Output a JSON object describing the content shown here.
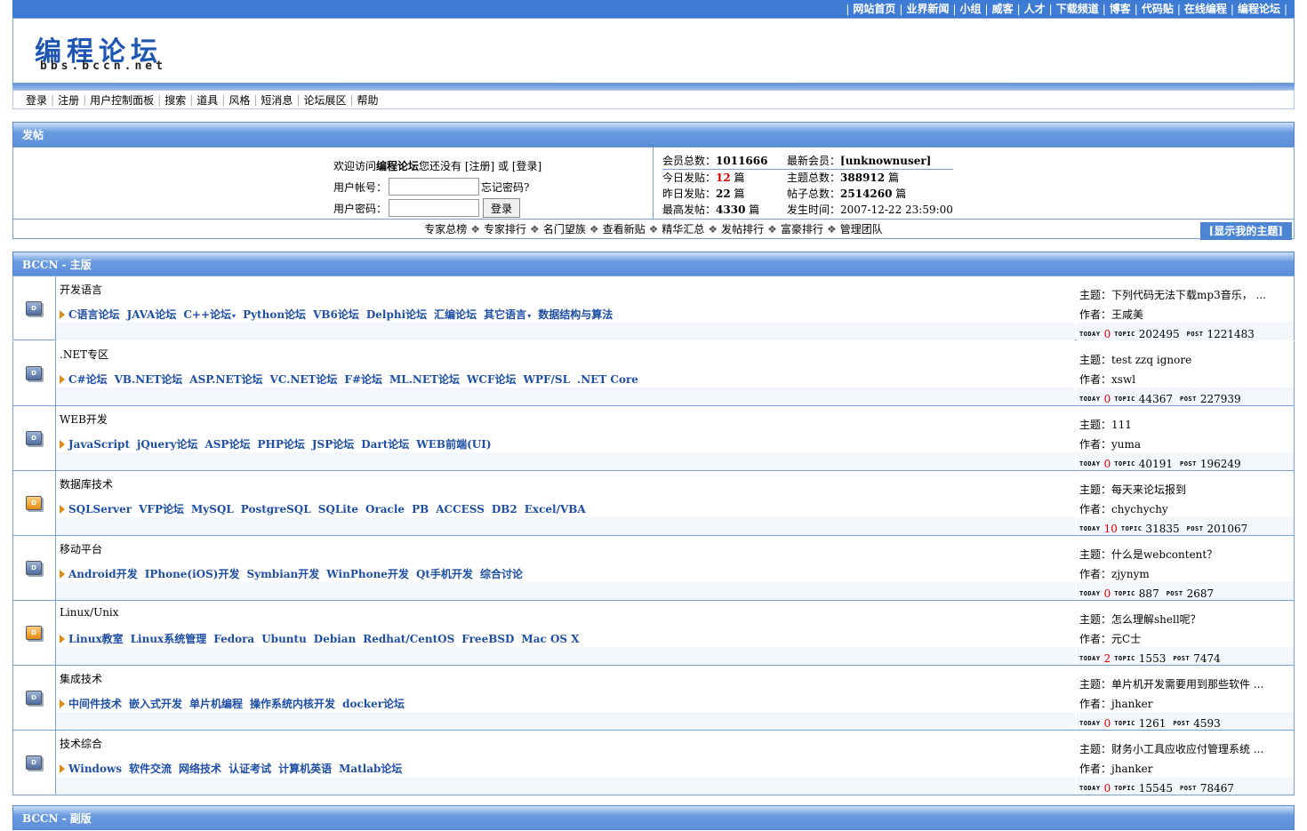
{
  "top_links": [
    "网站首页",
    "业界新闻",
    "小组",
    "威客",
    "人才",
    "下载频道",
    "博客",
    "代码贴",
    "在线编程",
    "编程论坛"
  ],
  "logo": {
    "main": "编程论坛",
    "sub": "bbs.bccn.net"
  },
  "menu": [
    "登录",
    "注册",
    "用户控制面板",
    "搜索",
    "道具",
    "风格",
    "短消息",
    "论坛展区",
    "帮助"
  ],
  "post_section": {
    "title": "发帖"
  },
  "login": {
    "welcome_prefix": "欢迎访问 ",
    "site": "编程论坛",
    "welcome_suffix": " 您还没有 [注册] 或 [登录]",
    "account_label": "用户帐号：",
    "forgot": "忘记密码?",
    "password_label": "用户密码：",
    "button": "登录"
  },
  "stats": {
    "members_label": "会员总数：",
    "members": "1011666",
    "newest_label": "最新会员：",
    "newest": "[unknownuser]",
    "today_label": "今日发贴：",
    "today": "12",
    "unit": " 篇",
    "topics_label": "主题总数：",
    "topics": "388912",
    "yesterday_label": "昨日发贴：",
    "yesterday": "22",
    "posts_label": "帖子总数：",
    "posts": "2514260",
    "max_label": "最高发帖：",
    "max": "4330",
    "time_label": "发生时间：",
    "time": "2007-12-22 23:59:00"
  },
  "tools": [
    "专家总榜",
    "专家排行",
    "名门望族",
    "查看新贴",
    "精华汇总",
    "发帖排行",
    "富豪排行",
    "管理团队"
  ],
  "my_topics": "[显示我的主题]",
  "main_section": {
    "title": "BCCN - 主版"
  },
  "sub_section": {
    "title": "BCCN - 副版"
  },
  "labels": {
    "topic": "主题：",
    "author": "作者：",
    "today_tag": "TODAY",
    "topic_tag": "TOPIC",
    "post_tag": "POST",
    "dropdown": "▾"
  },
  "forums": [
    {
      "name": "开发语言",
      "icon": "blue",
      "subs": [
        {
          "t": "C语言论坛"
        },
        {
          "t": "JAVA论坛"
        },
        {
          "t": "C++论坛",
          "dd": true
        },
        {
          "t": "Python论坛"
        },
        {
          "t": "VB6论坛"
        },
        {
          "t": "Delphi论坛"
        },
        {
          "t": "汇编论坛"
        },
        {
          "t": "其它语言",
          "dd": true
        },
        {
          "t": "数据结构与算法"
        }
      ],
      "last_topic": "下列代码无法下载mp3音乐， ...",
      "author": "王咸美",
      "today": "0",
      "topics": "202495",
      "posts": "1221483"
    },
    {
      "name": ".NET专区",
      "icon": "blue",
      "subs": [
        {
          "t": "C#论坛"
        },
        {
          "t": "VB.NET论坛"
        },
        {
          "t": "ASP.NET论坛"
        },
        {
          "t": "VC.NET论坛"
        },
        {
          "t": "F#论坛"
        },
        {
          "t": "ML.NET论坛"
        },
        {
          "t": "WCF论坛"
        },
        {
          "t": "WPF/SL"
        },
        {
          "t": ".NET Core"
        }
      ],
      "last_topic": "test zzq ignore",
      "author": "xswl",
      "today": "0",
      "topics": "44367",
      "posts": "227939"
    },
    {
      "name": "WEB开发",
      "icon": "blue",
      "subs": [
        {
          "t": "JavaScript"
        },
        {
          "t": "jQuery论坛"
        },
        {
          "t": "ASP论坛"
        },
        {
          "t": "PHP论坛"
        },
        {
          "t": "JSP论坛"
        },
        {
          "t": "Dart论坛"
        },
        {
          "t": "WEB前端(UI)"
        }
      ],
      "last_topic": "111",
      "author": "yuma",
      "today": "0",
      "topics": "40191",
      "posts": "196249"
    },
    {
      "name": "数据库技术",
      "icon": "orange",
      "subs": [
        {
          "t": "SQLServer"
        },
        {
          "t": "VFP论坛"
        },
        {
          "t": "MySQL"
        },
        {
          "t": "PostgreSQL"
        },
        {
          "t": "SQLite"
        },
        {
          "t": "Oracle"
        },
        {
          "t": "PB"
        },
        {
          "t": "ACCESS"
        },
        {
          "t": "DB2"
        },
        {
          "t": "Excel/VBA"
        }
      ],
      "last_topic": "每天来论坛报到",
      "author": "chychychy",
      "today": "10",
      "topics": "31835",
      "posts": "201067"
    },
    {
      "name": "移动平台",
      "icon": "blue",
      "subs": [
        {
          "t": "Android开发"
        },
        {
          "t": "IPhone(iOS)开发"
        },
        {
          "t": "Symbian开发"
        },
        {
          "t": "WinPhone开发"
        },
        {
          "t": "Qt手机开发"
        },
        {
          "t": "综合讨论"
        }
      ],
      "last_topic": "什么是webcontent？",
      "author": "zjynym",
      "today": "0",
      "topics": "887",
      "posts": "2687"
    },
    {
      "name": "Linux/Unix",
      "icon": "orange",
      "subs": [
        {
          "t": "Linux教室"
        },
        {
          "t": "Linux系统管理"
        },
        {
          "t": "Fedora"
        },
        {
          "t": "Ubuntu"
        },
        {
          "t": "Debian"
        },
        {
          "t": "Redhat/CentOS"
        },
        {
          "t": "FreeBSD"
        },
        {
          "t": "Mac OS X"
        }
      ],
      "last_topic": "怎么理解shell呢？",
      "author": "元C士",
      "today": "2",
      "topics": "1553",
      "posts": "7474"
    },
    {
      "name": "集成技术",
      "icon": "blue",
      "subs": [
        {
          "t": "中间件技术"
        },
        {
          "t": "嵌入式开发"
        },
        {
          "t": "单片机编程"
        },
        {
          "t": "操作系统内核开发"
        },
        {
          "t": "docker论坛"
        }
      ],
      "last_topic": "单片机开发需要用到那些软件 ...",
      "author": "jhanker",
      "today": "0",
      "topics": "1261",
      "posts": "4593"
    },
    {
      "name": "技术综合",
      "icon": "blue",
      "subs": [
        {
          "t": "Windows"
        },
        {
          "t": "软件交流"
        },
        {
          "t": "网络技术"
        },
        {
          "t": "认证考试"
        },
        {
          "t": "计算机英语"
        },
        {
          "t": "Matlab论坛"
        }
      ],
      "last_topic": "财务小工具应收应付管理系统 ...",
      "author": "jhanker",
      "today": "0",
      "topics": "15545",
      "posts": "78467"
    }
  ]
}
